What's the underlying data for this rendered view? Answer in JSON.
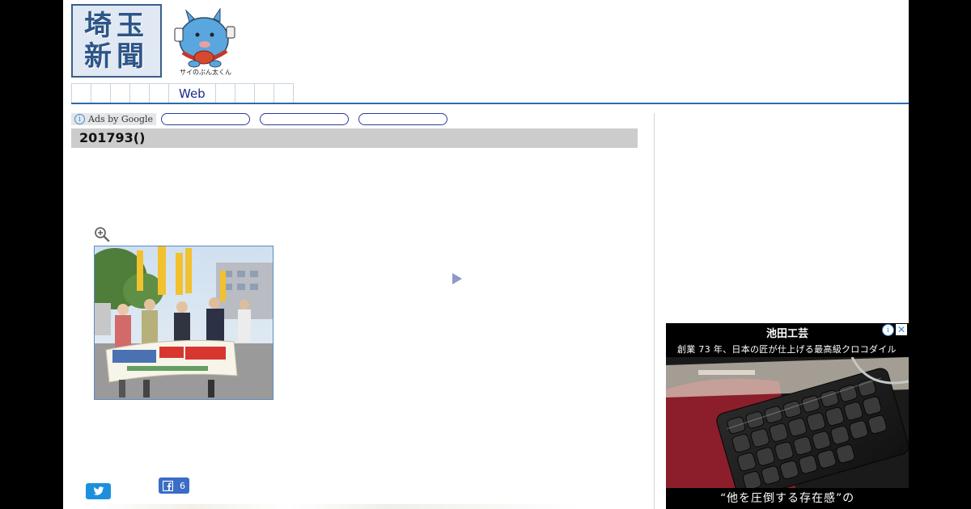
{
  "header": {
    "logo_lines": [
      "埼玉",
      "新聞"
    ],
    "mascot_caption": "サイのぶん太くん"
  },
  "nav": {
    "items": [
      "",
      "",
      "",
      "",
      "",
      "Web",
      "",
      "",
      "",
      ""
    ]
  },
  "ads_bar": {
    "label": "Ads by Google",
    "info_glyph": "i"
  },
  "article": {
    "title": "201793()"
  },
  "social": {
    "facebook_count": "6"
  },
  "side_ad": {
    "brand": "池田工芸",
    "description": "創業 73 年、日本の匠が仕上げる最高級クロコダイル",
    "footer": "“他を圧倒する存在感”の",
    "choice_info": "i",
    "choice_close": "✕"
  },
  "colors": {
    "nav_text": "#1a2b8a",
    "nav_rule": "#2e6aa7",
    "twitter": "#1d90dd",
    "facebook": "#3b6cc6",
    "title_bar": "#cccccc"
  }
}
